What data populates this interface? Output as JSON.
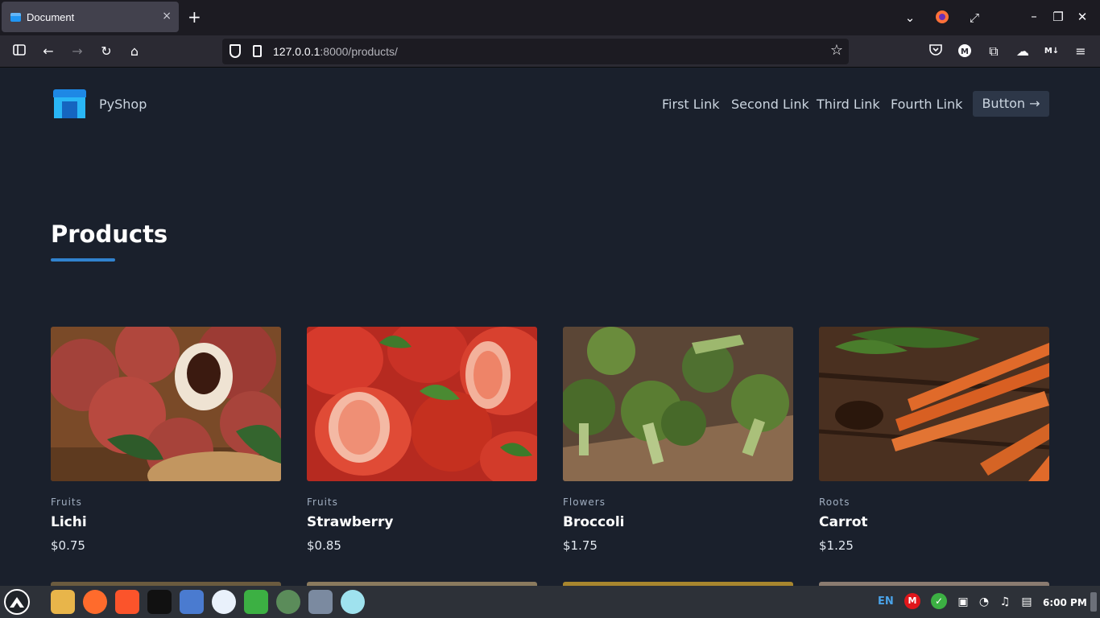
{
  "browser": {
    "tab_title": "Document",
    "tab_close": "×",
    "new_tab": "+",
    "url_host": "127.0.0.1",
    "url_rest": ":8000/products/",
    "star": "☆"
  },
  "site": {
    "brand": "PyShop",
    "links": [
      "First Link",
      "Second Link",
      "Third Link",
      "Fourth Link"
    ],
    "button": "Button →"
  },
  "page": {
    "title": "Products"
  },
  "products": [
    {
      "category": "Fruits",
      "name": "Lichi",
      "price": "$0.75"
    },
    {
      "category": "Fruits",
      "name": "Strawberry",
      "price": "$0.85"
    },
    {
      "category": "Flowers",
      "name": "Broccoli",
      "price": "$1.75"
    },
    {
      "category": "Roots",
      "name": "Carrot",
      "price": "$1.25"
    }
  ],
  "taskbar": {
    "lang": "EN",
    "time": "6:00 PM"
  },
  "colors": {
    "accent": "#3182ce",
    "page_bg": "#1a202c"
  }
}
